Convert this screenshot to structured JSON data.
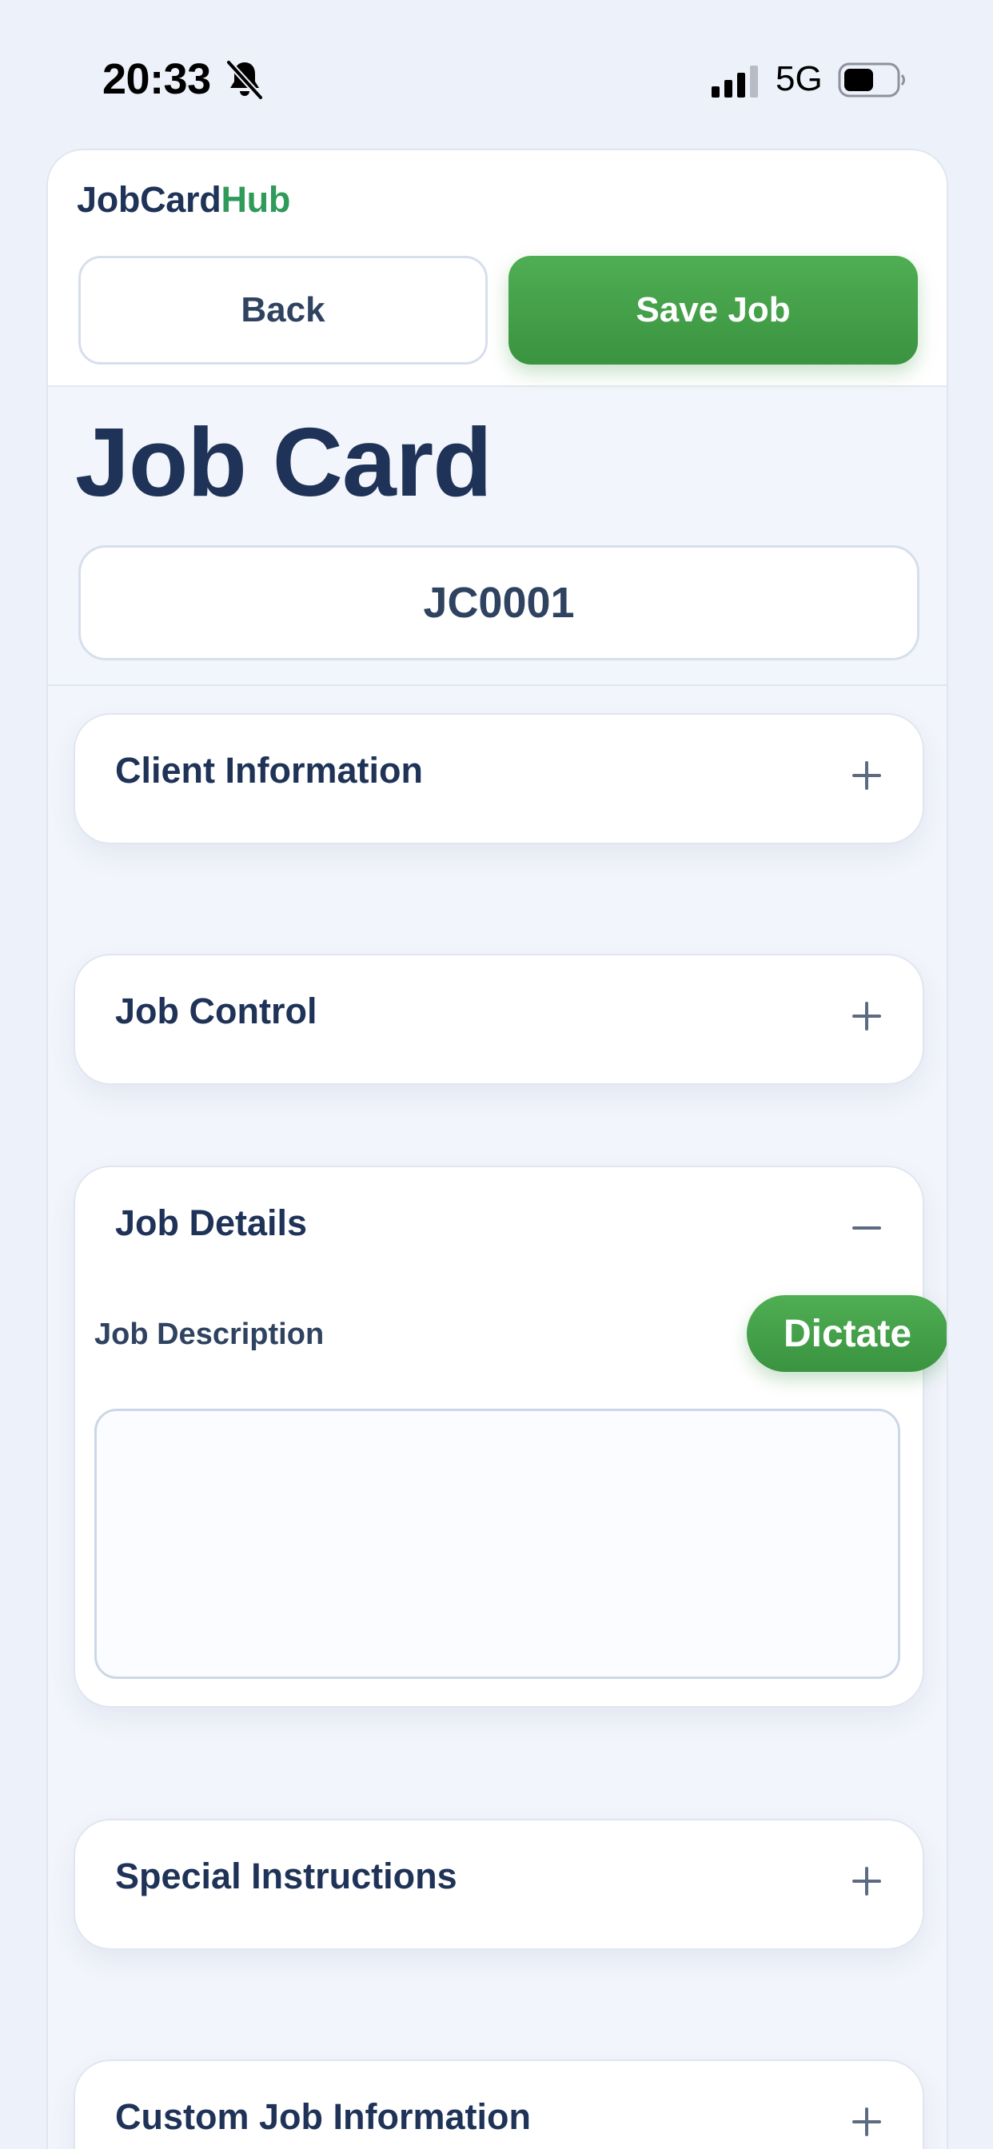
{
  "status_bar": {
    "time": "20:33",
    "network": "5G",
    "icons": [
      "bell-slash-icon",
      "signal-icon",
      "battery-icon"
    ]
  },
  "app": {
    "brand_part1": "JobCard",
    "brand_part2": "Hub",
    "back_label": "Back",
    "save_label": "Save Job"
  },
  "page": {
    "title": "Job Card",
    "job_id": "JC0001"
  },
  "sections": {
    "client_information": {
      "title": "Client Information",
      "expanded": false
    },
    "job_control": {
      "title": "Job Control",
      "expanded": false
    },
    "job_details": {
      "title": "Job Details",
      "expanded": true,
      "description_label": "Job Description",
      "description_value": "",
      "dictate_label": "Dictate"
    },
    "special_instructions": {
      "title": "Special Instructions",
      "expanded": false
    },
    "custom_job_information": {
      "title": "Custom Job Information",
      "expanded": false
    }
  },
  "colors": {
    "primary_text": "#1f3358",
    "brand_green": "#2f9a5a",
    "button_green": "#43a047",
    "background": "#edf1f9"
  }
}
